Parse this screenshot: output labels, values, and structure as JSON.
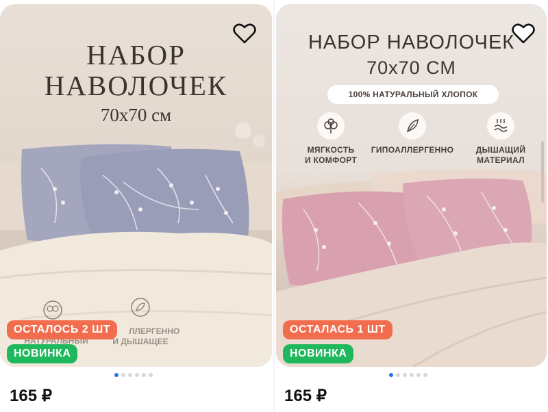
{
  "cards": [
    {
      "title_line1": "НАБОР",
      "title_line2": "НАВОЛОЧЕК",
      "title_line3": "70х70 см",
      "feature_ghost_1": "НАТУРАЛЬНЫЙ",
      "feature_ghost_2a": "ЛЛЕРГЕННО",
      "feature_ghost_2b": "И ДЫШАЩЕЕ",
      "badge_stock": "ОСТАЛОСЬ 2 ШТ",
      "badge_new": "НОВИНКА",
      "price": "165 ₽",
      "carousel_active_index": 0,
      "carousel_count": 6
    },
    {
      "title_line1": "НАБОР НАВОЛОЧЕК",
      "title_line2": "70х70 СМ",
      "pill": "100% НАТУРАЛЬНЫЙ ХЛОПОК",
      "features": [
        {
          "icon": "cotton-icon",
          "label": "МЯГКОСТЬ\nИ КОМФОРТ"
        },
        {
          "icon": "feather-icon",
          "label": "ГИПОАЛЛЕРГЕННО"
        },
        {
          "icon": "breathable-icon",
          "label": "ДЫШАЩИЙ\nМАТЕРИАЛ"
        }
      ],
      "badge_stock": "ОСТАЛАСЬ 1 ШТ",
      "badge_new": "НОВИНКА",
      "price": "165 ₽",
      "carousel_active_index": 0,
      "carousel_count": 6
    }
  ],
  "colors": {
    "badge_stock": "#f26d4e",
    "badge_new": "#1fb85c",
    "carousel_active": "#2b6ef2",
    "pillow_left": "#9fa3bd",
    "pillow_right": "#d9a3b0"
  }
}
